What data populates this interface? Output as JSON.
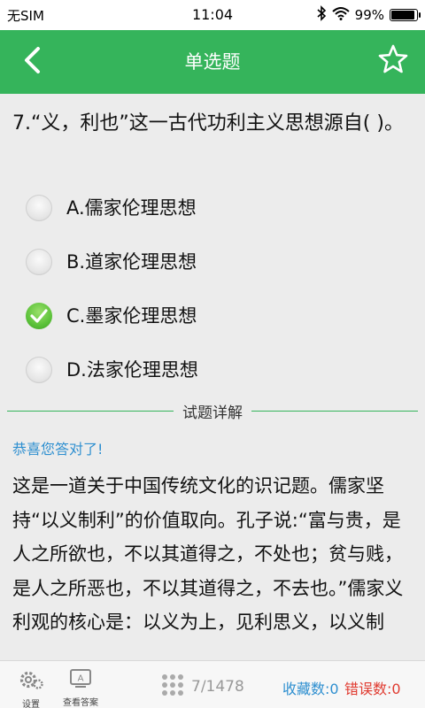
{
  "status_bar": {
    "carrier": "无SIM",
    "time": "11:04",
    "battery": "99%",
    "icons": [
      "bluetooth-icon",
      "wifi-icon",
      "battery-icon"
    ]
  },
  "nav": {
    "title": "单选题",
    "back_icon": "chevron-left-icon",
    "favorite_icon": "star-outline-icon"
  },
  "question": {
    "text": "7.“义，利也”这一古代功利主义思想源自( )。"
  },
  "options": [
    {
      "label": "A.儒家伦理思想",
      "selected": false
    },
    {
      "label": "B.道家伦理思想",
      "selected": false
    },
    {
      "label": "C.墨家伦理思想",
      "selected": true
    },
    {
      "label": "D.法家伦理思想",
      "selected": false
    }
  ],
  "detail": {
    "heading": "试题详解",
    "feedback": "恭喜您答对了!",
    "explanation": "这是一道关于中国传统文化的识记题。儒家坚持“以义制利”的价值取向。孔子说:“富与贵，是人之所欲也，不以其道得之，不处也；贫与贱，是人之所恶也，不以其道得之，不去也。”儒家义利观的核心是：以义为上，见利思义，以义制"
  },
  "bottom_bar": {
    "settings_label": "设置",
    "answers_label": "查看答案",
    "progress": "7/1478",
    "favorites": "收藏数:0",
    "errors": "错误数:0"
  },
  "colors": {
    "primary_green": "#35b45b",
    "link_blue": "#2e8fd0",
    "error_red": "#e03b30"
  }
}
